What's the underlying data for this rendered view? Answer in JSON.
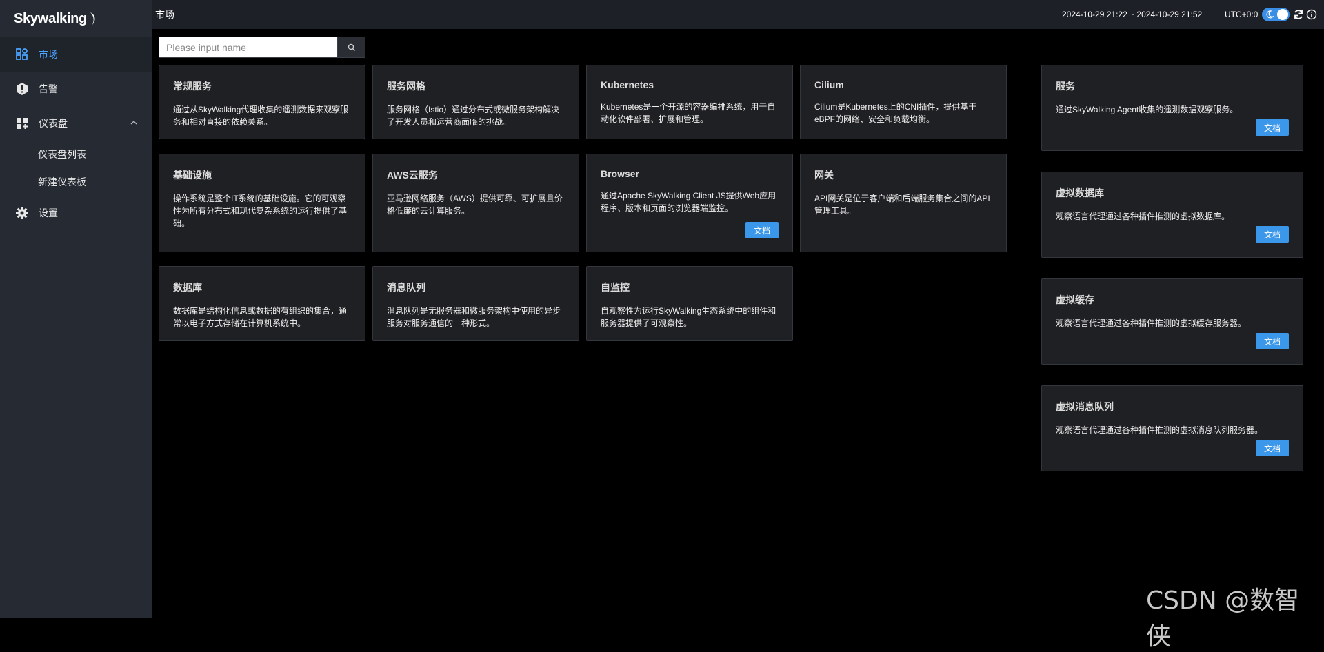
{
  "brand": {
    "name": "Skywalking"
  },
  "sidebar": {
    "items": [
      {
        "label": "市场",
        "icon": "marketplace-icon",
        "active": true
      },
      {
        "label": "告警",
        "icon": "alert-icon"
      },
      {
        "label": "仪表盘",
        "icon": "dashboard-icon",
        "expanded": true,
        "children": [
          {
            "label": "仪表盘列表"
          },
          {
            "label": "新建仪表板"
          }
        ]
      },
      {
        "label": "设置",
        "icon": "gear-icon"
      }
    ]
  },
  "header": {
    "title": "市场",
    "time_range": "2024-10-29 21:22 ~ 2024-10-29 21:52",
    "timezone": "UTC+0:0"
  },
  "search": {
    "placeholder": "Please input name"
  },
  "cards": [
    {
      "title": "常规服务",
      "desc": "通过从SkyWalking代理收集的遥测数据来观察服务和相对直接的依赖关系。"
    },
    {
      "title": "服务网格",
      "desc": "服务网格（Istio）通过分布式或微服务架构解决了开发人员和运营商面临的挑战。"
    },
    {
      "title": "Kubernetes",
      "desc": "Kubernetes是一个开源的容器编排系统，用于自动化软件部署、扩展和管理。"
    },
    {
      "title": "Cilium",
      "desc": "Cilium是Kubernetes上的CNI插件，提供基于eBPF的网络、安全和负载均衡。"
    },
    {
      "title": "基础设施",
      "desc": "操作系统是整个IT系统的基础设施。它的可观察性为所有分布式和现代复杂系统的运行提供了基础。"
    },
    {
      "title": "AWS云服务",
      "desc": "亚马逊网络服务（AWS）提供可靠、可扩展且价格低廉的云计算服务。"
    },
    {
      "title": "Browser",
      "desc": "通过Apache SkyWalking Client JS提供Web应用程序、版本和页面的浏览器端监控。",
      "button": "文档"
    },
    {
      "title": "网关",
      "desc": "API网关是位于客户端和后端服务集合之间的API管理工具。"
    },
    {
      "title": "数据库",
      "desc": "数据库是结构化信息或数据的有组织的集合，通常以电子方式存储在计算机系统中。"
    },
    {
      "title": "消息队列",
      "desc": "消息队列是无服务器和微服务架构中使用的异步服务对服务通信的一种形式。"
    },
    {
      "title": "自监控",
      "desc": "自观察性为运行SkyWalking生态系统中的组件和服务器提供了可观察性。"
    }
  ],
  "right_cards": [
    {
      "title": "服务",
      "desc": "通过SkyWalking Agent收集的遥测数据观察服务。",
      "button": "文档"
    },
    {
      "title": "虚拟数据库",
      "desc": "观察语言代理通过各种插件推测的虚拟数据库。",
      "button": "文档"
    },
    {
      "title": "虚拟缓存",
      "desc": "观察语言代理通过各种插件推测的虚拟缓存服务器。",
      "button": "文档"
    },
    {
      "title": "虚拟消息队列",
      "desc": "观察语言代理通过各种插件推测的虚拟消息队列服务器。",
      "button": "文档"
    }
  ],
  "watermark": "CSDN @数智侠",
  "colors": {
    "accent": "#3b97ea",
    "sidebar_bg": "#252a33",
    "card_bg": "#1f2023"
  }
}
